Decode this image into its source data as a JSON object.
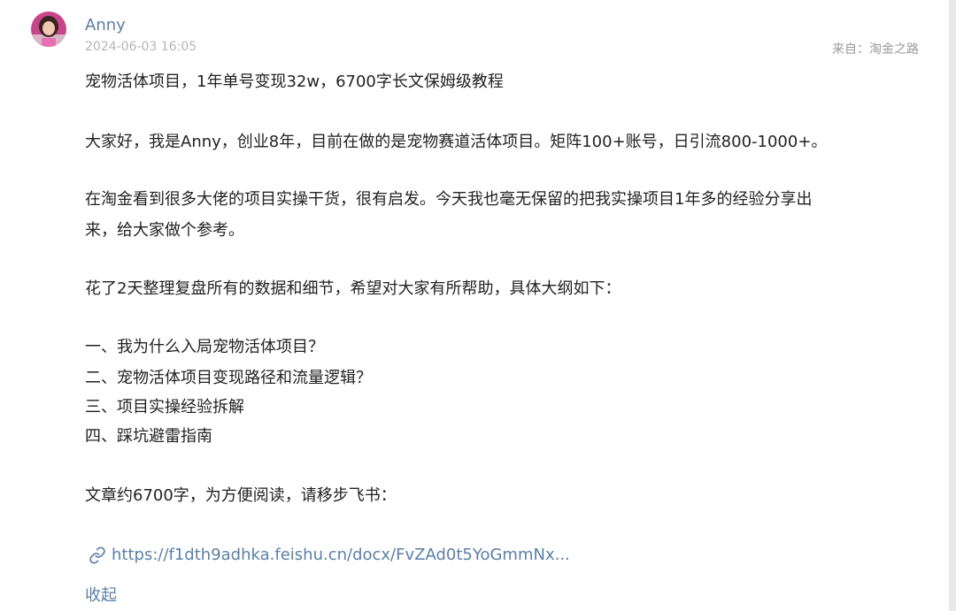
{
  "post": {
    "author": "Anny",
    "timestamp": "2024-06-03 16:05",
    "source_prefix": "来自：",
    "source_name": "淘金之路",
    "title": "宠物活体项目，1年单号变现32w，6700字长文保姆级教程",
    "intro": "大家好，我是Anny，创业8年，目前在做的是宠物赛道活体项目。矩阵100+账号，日引流800-1000+。",
    "para2_line1": "在淘金看到很多大佬的项目实操干货，很有启发。今天我也毫无保留的把我实操项目1年多的经验分享出",
    "para2_line2": "来，给大家做个参考。",
    "para3": "花了2天整理复盘所有的数据和细节，希望对大家有所帮助，具体大纲如下：",
    "outline": [
      "一、我为什么入局宠物活体项目？",
      "二、宠物活体项目变现路径和流量逻辑？",
      "三、项目实操经验拆解",
      "四、踩坑避雷指南"
    ],
    "closing": "文章约6700字，为方便阅读，请移步飞书：",
    "link_text": "https://f1dth9adhka.feishu.cn/docx/FvZAd0t5YoGmmNx...",
    "collapse_label": "收起"
  },
  "icons": {
    "link": "link-icon",
    "avatar": "user-avatar"
  },
  "colors": {
    "link": "#5b7fa8",
    "meta": "#b5b5b5",
    "text": "#222222"
  }
}
